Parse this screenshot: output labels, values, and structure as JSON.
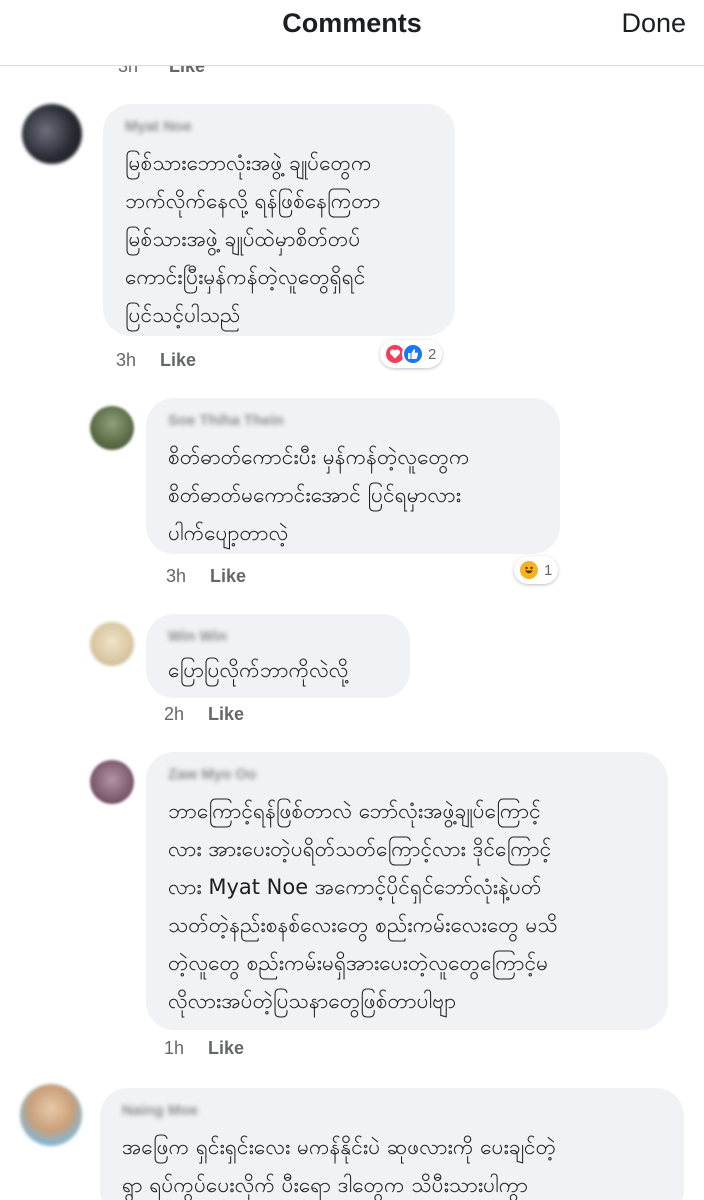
{
  "header": {
    "title": "Comments",
    "done_label": "Done"
  },
  "cut_meta": {
    "time": "3h",
    "like_label": "Like"
  },
  "comments": [
    {
      "author": "Myat Noe",
      "text": "မြစ်သားဘောလုံးအဖွဲ့ ချုပ်တွေက\nဘက်လိုက်နေလို့ ရန်ဖြစ်နေကြတာ\nမြစ်သားအဖွဲ့ ချုပ်ထဲမှာစိတ်တပ်\nကောင်းပြီးမှန်ကန်တဲ့လူတွေရှိရင်\nပြင်သင့်ပါသည်",
      "time": "3h",
      "like_label": "Like",
      "reaction_count": "2"
    },
    {
      "author": "Soe Thiha Thein",
      "text": "စိတ်ဓာတ်ကောင်းပီး မှန်ကန်တဲ့လူတွေက\nစိတ်ဓာတ်မကောင်းအောင် ပြင်ရမှာလား\nပါက်ပျော့တာလဲ့",
      "time": "3h",
      "like_label": "Like",
      "reaction_count": "1"
    },
    {
      "author": "Win Win",
      "text": "ပြောပြလိုက်ဘာကိုလဲလို့",
      "time": "2h",
      "like_label": "Like"
    },
    {
      "author": "Zaw Myo Oo",
      "text": "ဘာကြောင့်ရန်ဖြစ်တာလဲ ဘော်လုံးအဖွဲ့ချုပ်ကြောင့်\nလား အားပေးတဲ့ပရိတ်သတ်ကြောင့်လား ဒိုင်ကြောင့်\nလား Myat Noe အကောင့်ပိုင်ရှင်ဘော်လုံးနဲ့ပတ်\nသတ်တဲ့နည်းစနစ်လေးတွေ စည်းကမ်းလေးတွေ မသိ\nတဲ့လူတွေ စည်းကမ်းမရှိအားပေးတဲ့လူတွေကြောင့်မ\nလိုလားအပ်တဲ့ပြသနာတွေဖြစ်တာပါဗျာ",
      "time": "1h",
      "like_label": "Like"
    },
    {
      "author": "Naing Moe",
      "text": "အဖြေက ရှင်းရှင်းလေး မကန်နိုင်းပဲ ဆုဖလားကို ပေးချင်တဲ့\nရွာ ရပ်ကွပ်ပေးလိုက် ပီးရော ဒါတွေက သိပီးသားပါကွာ"
    }
  ],
  "colors": {
    "love": "#f33e58",
    "like": "#1877f2",
    "haha": "#f7b125"
  },
  "icons": [
    "love-reaction-icon",
    "like-reaction-icon",
    "haha-reaction-icon"
  ]
}
